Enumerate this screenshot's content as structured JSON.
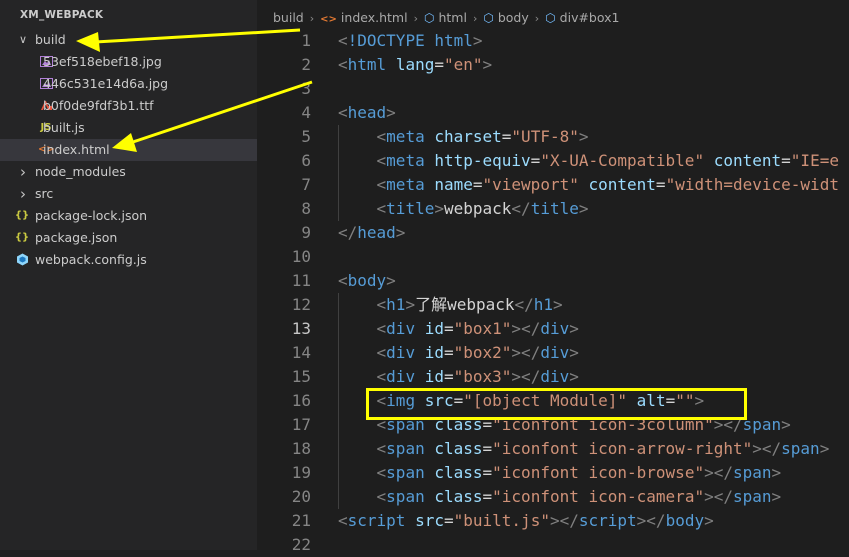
{
  "explorer": {
    "title": "XM_WEBPACK",
    "items": [
      {
        "label": "build",
        "kind": "folder-open",
        "icon": "chevron-down-icon",
        "depth": 0
      },
      {
        "label": "53ef518ebef18.jpg",
        "kind": "image",
        "icon": "image-file-icon",
        "depth": 1
      },
      {
        "label": "446c531e14d6a.jpg",
        "kind": "image",
        "icon": "image-file-icon",
        "depth": 1
      },
      {
        "label": "b0f0de9fdf3b1.ttf",
        "kind": "font",
        "icon": "font-file-icon",
        "depth": 1
      },
      {
        "label": "built.js",
        "kind": "js",
        "icon": "js-file-icon",
        "icon_text": "JS",
        "depth": 1
      },
      {
        "label": "index.html",
        "kind": "html",
        "icon": "html-file-icon",
        "icon_text": "<>",
        "depth": 1,
        "selected": true
      },
      {
        "label": "node_modules",
        "kind": "folder",
        "icon": "chevron-right-icon",
        "depth": 0
      },
      {
        "label": "src",
        "kind": "folder",
        "icon": "chevron-right-icon",
        "depth": 0
      },
      {
        "label": "package-lock.json",
        "kind": "json",
        "icon": "json-file-icon",
        "icon_text": "{}",
        "depth": 0
      },
      {
        "label": "package.json",
        "kind": "json",
        "icon": "json-file-icon",
        "icon_text": "{}",
        "depth": 0
      },
      {
        "label": "webpack.config.js",
        "kind": "config",
        "icon": "webpack-file-icon",
        "depth": 0
      }
    ]
  },
  "breadcrumb": [
    "build",
    "index.html",
    "html",
    "body",
    "div#box1"
  ],
  "editor": {
    "active_line": 13,
    "lines": [
      {
        "n": "1",
        "tokens": [
          [
            "br",
            "<"
          ],
          [
            "tag",
            "!DOCTYPE"
          ],
          [
            "text",
            " "
          ],
          [
            "tag",
            "html"
          ],
          [
            "br",
            ">"
          ]
        ]
      },
      {
        "n": "2",
        "tokens": [
          [
            "br",
            "<"
          ],
          [
            "tag",
            "html"
          ],
          [
            "text",
            " "
          ],
          [
            "attr",
            "lang"
          ],
          [
            "text",
            "="
          ],
          [
            "str",
            "\"en\""
          ],
          [
            "br",
            ">"
          ]
        ]
      },
      {
        "n": "3",
        "tokens": []
      },
      {
        "n": "4",
        "tokens": [
          [
            "br",
            "<"
          ],
          [
            "tag",
            "head"
          ],
          [
            "br",
            ">"
          ]
        ]
      },
      {
        "n": "5",
        "tokens": [
          [
            "text",
            "    "
          ],
          [
            "br",
            "<"
          ],
          [
            "tag",
            "meta"
          ],
          [
            "text",
            " "
          ],
          [
            "attr",
            "charset"
          ],
          [
            "text",
            "="
          ],
          [
            "str",
            "\"UTF-8\""
          ],
          [
            "br",
            ">"
          ]
        ]
      },
      {
        "n": "6",
        "tokens": [
          [
            "text",
            "    "
          ],
          [
            "br",
            "<"
          ],
          [
            "tag",
            "meta"
          ],
          [
            "text",
            " "
          ],
          [
            "attr",
            "http-equiv"
          ],
          [
            "text",
            "="
          ],
          [
            "str",
            "\"X-UA-Compatible\""
          ],
          [
            "text",
            " "
          ],
          [
            "attr",
            "content"
          ],
          [
            "text",
            "="
          ],
          [
            "str",
            "\"IE=e"
          ]
        ]
      },
      {
        "n": "7",
        "tokens": [
          [
            "text",
            "    "
          ],
          [
            "br",
            "<"
          ],
          [
            "tag",
            "meta"
          ],
          [
            "text",
            " "
          ],
          [
            "attr",
            "name"
          ],
          [
            "text",
            "="
          ],
          [
            "str",
            "\"viewport\""
          ],
          [
            "text",
            " "
          ],
          [
            "attr",
            "content"
          ],
          [
            "text",
            "="
          ],
          [
            "str",
            "\"width=device-widt"
          ]
        ]
      },
      {
        "n": "8",
        "tokens": [
          [
            "text",
            "    "
          ],
          [
            "br",
            "<"
          ],
          [
            "tag",
            "title"
          ],
          [
            "br",
            ">"
          ],
          [
            "text",
            "webpack"
          ],
          [
            "br",
            "</"
          ],
          [
            "tag",
            "title"
          ],
          [
            "br",
            ">"
          ]
        ]
      },
      {
        "n": "9",
        "tokens": [
          [
            "br",
            "</"
          ],
          [
            "tag",
            "head"
          ],
          [
            "br",
            ">"
          ]
        ]
      },
      {
        "n": "10",
        "tokens": []
      },
      {
        "n": "11",
        "tokens": [
          [
            "br",
            "<"
          ],
          [
            "tag",
            "body"
          ],
          [
            "br",
            ">"
          ]
        ]
      },
      {
        "n": "12",
        "tokens": [
          [
            "text",
            "    "
          ],
          [
            "br",
            "<"
          ],
          [
            "tag",
            "h1"
          ],
          [
            "br",
            ">"
          ],
          [
            "text",
            "了解webpack"
          ],
          [
            "br",
            "</"
          ],
          [
            "tag",
            "h1"
          ],
          [
            "br",
            ">"
          ]
        ]
      },
      {
        "n": "13",
        "tokens": [
          [
            "text",
            "    "
          ],
          [
            "br",
            "<"
          ],
          [
            "tag",
            "div"
          ],
          [
            "text",
            " "
          ],
          [
            "attr",
            "id"
          ],
          [
            "text",
            "="
          ],
          [
            "str",
            "\"box1\""
          ],
          [
            "br",
            ">"
          ],
          [
            "br",
            "</"
          ],
          [
            "tag",
            "div"
          ],
          [
            "br",
            ">"
          ]
        ]
      },
      {
        "n": "14",
        "tokens": [
          [
            "text",
            "    "
          ],
          [
            "br",
            "<"
          ],
          [
            "tag",
            "div"
          ],
          [
            "text",
            " "
          ],
          [
            "attr",
            "id"
          ],
          [
            "text",
            "="
          ],
          [
            "str",
            "\"box2\""
          ],
          [
            "br",
            "></"
          ],
          [
            "tag",
            "div"
          ],
          [
            "br",
            ">"
          ]
        ]
      },
      {
        "n": "15",
        "tokens": [
          [
            "text",
            "    "
          ],
          [
            "br",
            "<"
          ],
          [
            "tag",
            "div"
          ],
          [
            "text",
            " "
          ],
          [
            "attr",
            "id"
          ],
          [
            "text",
            "="
          ],
          [
            "str",
            "\"box3\""
          ],
          [
            "br",
            "></"
          ],
          [
            "tag",
            "div"
          ],
          [
            "br",
            ">"
          ]
        ]
      },
      {
        "n": "16",
        "tokens": [
          [
            "text",
            "    "
          ],
          [
            "br",
            "<"
          ],
          [
            "tag",
            "img"
          ],
          [
            "text",
            " "
          ],
          [
            "attr",
            "src"
          ],
          [
            "text",
            "="
          ],
          [
            "str",
            "\"[object Module]\""
          ],
          [
            "text",
            " "
          ],
          [
            "attr",
            "alt"
          ],
          [
            "text",
            "="
          ],
          [
            "str",
            "\"\""
          ],
          [
            "br",
            ">"
          ]
        ]
      },
      {
        "n": "17",
        "tokens": [
          [
            "text",
            "    "
          ],
          [
            "br",
            "<"
          ],
          [
            "tag",
            "span"
          ],
          [
            "text",
            " "
          ],
          [
            "attr",
            "class"
          ],
          [
            "text",
            "="
          ],
          [
            "str",
            "\"iconfont icon-3column\""
          ],
          [
            "br",
            "></"
          ],
          [
            "tag",
            "span"
          ],
          [
            "br",
            ">"
          ]
        ]
      },
      {
        "n": "18",
        "tokens": [
          [
            "text",
            "    "
          ],
          [
            "br",
            "<"
          ],
          [
            "tag",
            "span"
          ],
          [
            "text",
            " "
          ],
          [
            "attr",
            "class"
          ],
          [
            "text",
            "="
          ],
          [
            "str",
            "\"iconfont icon-arrow-right\""
          ],
          [
            "br",
            "></"
          ],
          [
            "tag",
            "span"
          ],
          [
            "br",
            ">"
          ]
        ]
      },
      {
        "n": "19",
        "tokens": [
          [
            "text",
            "    "
          ],
          [
            "br",
            "<"
          ],
          [
            "tag",
            "span"
          ],
          [
            "text",
            " "
          ],
          [
            "attr",
            "class"
          ],
          [
            "text",
            "="
          ],
          [
            "str",
            "\"iconfont icon-browse\""
          ],
          [
            "br",
            "></"
          ],
          [
            "tag",
            "span"
          ],
          [
            "br",
            ">"
          ]
        ]
      },
      {
        "n": "20",
        "tokens": [
          [
            "text",
            "    "
          ],
          [
            "br",
            "<"
          ],
          [
            "tag",
            "span"
          ],
          [
            "text",
            " "
          ],
          [
            "attr",
            "class"
          ],
          [
            "text",
            "="
          ],
          [
            "str",
            "\"iconfont icon-camera\""
          ],
          [
            "br",
            "></"
          ],
          [
            "tag",
            "span"
          ],
          [
            "br",
            ">"
          ]
        ]
      },
      {
        "n": "21",
        "tokens": [
          [
            "br",
            "<"
          ],
          [
            "tag",
            "script"
          ],
          [
            "text",
            " "
          ],
          [
            "attr",
            "src"
          ],
          [
            "text",
            "="
          ],
          [
            "str",
            "\"built.js\""
          ],
          [
            "br",
            "></"
          ],
          [
            "tag",
            "script"
          ],
          [
            "br",
            "></"
          ],
          [
            "tag",
            "body"
          ],
          [
            "br",
            ">"
          ]
        ]
      },
      {
        "n": "22",
        "tokens": []
      }
    ]
  },
  "annotations": {
    "arrow_color": "#ffff00",
    "highlight_color": "#ffff00"
  },
  "colors": {
    "tag": "#569cd6",
    "attr": "#9cdcfe",
    "string": "#ce9178",
    "bracket": "#808080",
    "text": "#d4d4d4"
  }
}
